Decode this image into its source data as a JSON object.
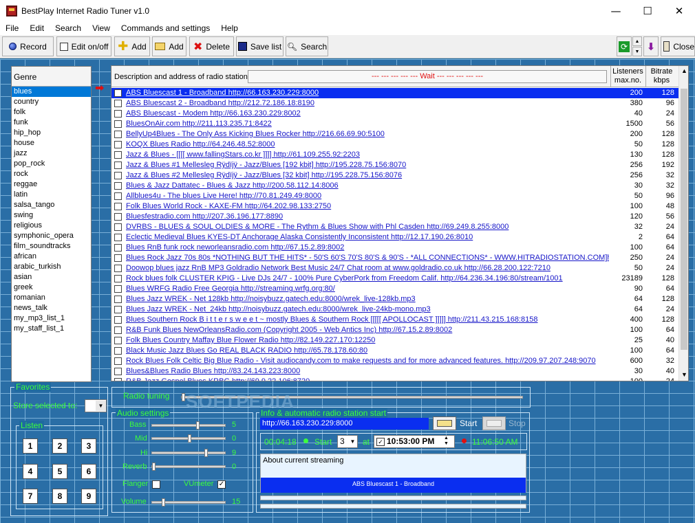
{
  "window": {
    "title": "BestPlay Internet Radio Tuner v1.0",
    "minimize": "—",
    "maximize": "☐",
    "close": "✕"
  },
  "menu": [
    "File",
    "Edit",
    "Search",
    "View",
    "Commands and settings",
    "Help"
  ],
  "toolbar": {
    "record": "Record",
    "edit": "Edit on/off",
    "add1": "Add",
    "add2": "Add",
    "delete": "Delete",
    "savelist": "Save list",
    "search": "Search",
    "close": "Close"
  },
  "genre": {
    "header": "Genre",
    "items": [
      "blues",
      "country",
      "folk",
      "funk",
      "hip_hop",
      "house",
      "jazz",
      "pop_rock",
      "rock",
      "reggae",
      "latin",
      "salsa_tango",
      "swing",
      "religious",
      "symphonic_opera",
      "film_soundtracks",
      "african",
      "arabic_turkish",
      "asian",
      "greek",
      "romanian",
      "news_talk",
      "my_mp3_list_1",
      "my_staff_list_1"
    ],
    "selected": 0
  },
  "stations": {
    "header_desc": "Description and address of radio stations",
    "status": "---  ---  ---  ---  ---  Wait  ---  ---  ---  ---  ---",
    "header_listeners": [
      "Listeners",
      "max.no."
    ],
    "header_bitrate": [
      "Bitrate",
      "kbps"
    ],
    "rows": [
      {
        "desc": "ABS Bluescast 1 - Broadband http://66.163.230.229:8000",
        "lis": "200",
        "bit": "128"
      },
      {
        "desc": "ABS Bluescast 2 - Broadband http://212.72.186.18:8190",
        "lis": "380",
        "bit": "96"
      },
      {
        "desc": "ABS Bluescast - Modem http://66.163.230.229:8002",
        "lis": "40",
        "bit": "24"
      },
      {
        "desc": "BluesOnAir.com http://211.113.235.71:8422",
        "lis": "1500",
        "bit": "56"
      },
      {
        "desc": "BellyUp4Blues - The Only Ass Kicking Blues Rocker http://216.66.69.90:5100",
        "lis": "200",
        "bit": "128"
      },
      {
        "desc": "KOQX Blues Radio http://64.246.48.52:8000",
        "lis": "50",
        "bit": "128"
      },
      {
        "desc": "Jazz & Blues - [[[[ www.fallingStars.co.kr ]]]] http://61.109.255.92:2203",
        "lis": "130",
        "bit": "128"
      },
      {
        "desc": "Jazz & Blues #1 Mellesleg Rÿdïjÿ - Jazz/Blues [192 kbit] http://195.228.75.156:8070",
        "lis": "256",
        "bit": "192"
      },
      {
        "desc": "Jazz & Blues #2 Mellesleg Rÿdïjÿ - Jazz/Blues [32 kbit] http://195.228.75.156:8076",
        "lis": "256",
        "bit": "32"
      },
      {
        "desc": "Blues & Jazz Dattatec - Blues & Jazz http://200.58.112.14:8006",
        "lis": "30",
        "bit": "32"
      },
      {
        "desc": "Allblues4u - The blues Live Here! http://70.81.249.49:8000",
        "lis": "50",
        "bit": "96"
      },
      {
        "desc": "Folk Blues World Rock - KAXE-FM http://64.202.98.133:2750",
        "lis": "100",
        "bit": "48"
      },
      {
        "desc": "Bluesfestradio.com http://207.36.196.177:8890",
        "lis": "120",
        "bit": "56"
      },
      {
        "desc": "DVRBS - BLUES & SOUL OLDIES & MORE - The Rythm & Blues Show with Phl Casden http://69.249.8.255:8000",
        "lis": "32",
        "bit": "24"
      },
      {
        "desc": "Eclectic Medieval Blues KYES-DT Anchorage Alaska Consistently Inconsistent http://12.17.190.26:8010",
        "lis": "2",
        "bit": "64"
      },
      {
        "desc": "Blues RnB funk rock neworleansradio.com http://67.15.2.89:8002",
        "lis": "100",
        "bit": "64"
      },
      {
        "desc": "Blues Rock Jazz 70s 80s *NOTHING BUT THE HITS* - 50'S 60'S 70'S 80'S & 90'S - *ALL CONNECTIONS* - WWW.HITRADIOSTATION.COM]h...",
        "lis": "250",
        "bit": "24"
      },
      {
        "desc": "Doowop blues jazz RnB MP3 Goldradio Network Best Music 24/7 Chat room at www.goldradio.co.uk http://66.28.200.122:7210",
        "lis": "50",
        "bit": "24"
      },
      {
        "desc": "Rock blues folk CLUSTER KPIG - Live DJs 24/7 - 100% Pure CyberPork from Freedom Calif. http://64.236.34.196:80/stream/1001",
        "lis": "23189",
        "bit": "128"
      },
      {
        "desc": "Blues WRFG Radio Free Georgia http://streaming.wrfg.org:80/",
        "lis": "90",
        "bit": "64"
      },
      {
        "desc": "Blues Jazz WREK - Net 128kb http://noisybuzz.gatech.edu:8000/wrek_live-128kb.mp3",
        "lis": "64",
        "bit": "128"
      },
      {
        "desc": "Blues Jazz WREK - Net_24kb http://noisybuzz.gatech.edu:8000/wrek_live-24kb-mono.mp3",
        "lis": "64",
        "bit": "24"
      },
      {
        "desc": "Blues Southern Rock B i t t e r s w e e t ~ mostly Blues & Southern Rock [[[[[ APOLLOCAST ]]]]] http://211.43.215.168:8158",
        "lis": "400",
        "bit": "128"
      },
      {
        "desc": "R&B Funk Blues NewOrleansRadio.com (Copyright 2005 - Web Antics Inc) http://67.15.2.89:8002",
        "lis": "100",
        "bit": "64"
      },
      {
        "desc": "Folk Blues Country Maffay Blue Flower Radio http://82.149.227.170:12250",
        "lis": "25",
        "bit": "40"
      },
      {
        "desc": "Black Music Jazz Blues Go REAL BLACK RADIO http://65.78.178.60:80",
        "lis": "100",
        "bit": "64"
      },
      {
        "desc": "Rock Blues Folk Celtic Big Blue Radio - Visit audiocandy.com to make requests and for more advanced features. http://209.97.207.248:9070",
        "lis": "600",
        "bit": "32"
      },
      {
        "desc": "Blues&Blues Radio Blues http://83.24.143.223:8000",
        "lis": "30",
        "bit": "40"
      },
      {
        "desc": "R&B Jazz Gospel Blues KRBG http://69.9.22.106:8720",
        "lis": "100",
        "bit": "24"
      }
    ]
  },
  "favorites": {
    "title": "Favorites",
    "store_label": "Store selected to:",
    "listen": "Listen",
    "buttons": [
      "1",
      "2",
      "3",
      "4",
      "5",
      "6",
      "7",
      "8",
      "9"
    ]
  },
  "tuning": {
    "title": "Radio tuning",
    "watermark": "SOFTPEDIA"
  },
  "audio": {
    "title": "Audio settings",
    "bass": "Bass",
    "bass_val": "5",
    "mid": "Mid",
    "mid_val": "0",
    "hi": "Hi",
    "hi_val": "9",
    "reverb": "Reverb",
    "reverb_val": "0",
    "flanger": "Flanger",
    "vumeter": "VUmeter",
    "volume": "Volume",
    "volume_val": "15"
  },
  "info": {
    "title": "Info & automatic radio station start",
    "url": "http://66.163.230.229:8000",
    "start": "Start",
    "stop": "Stop",
    "elapsed": "00:04:18",
    "start_label": "Start",
    "count": "3",
    "at": "at",
    "start_time": "10:53:00 PM",
    "clock": "11:06:50 AM",
    "about": "About current streaming",
    "now_playing": "ABS Bluescast 1 - Broadband"
  }
}
